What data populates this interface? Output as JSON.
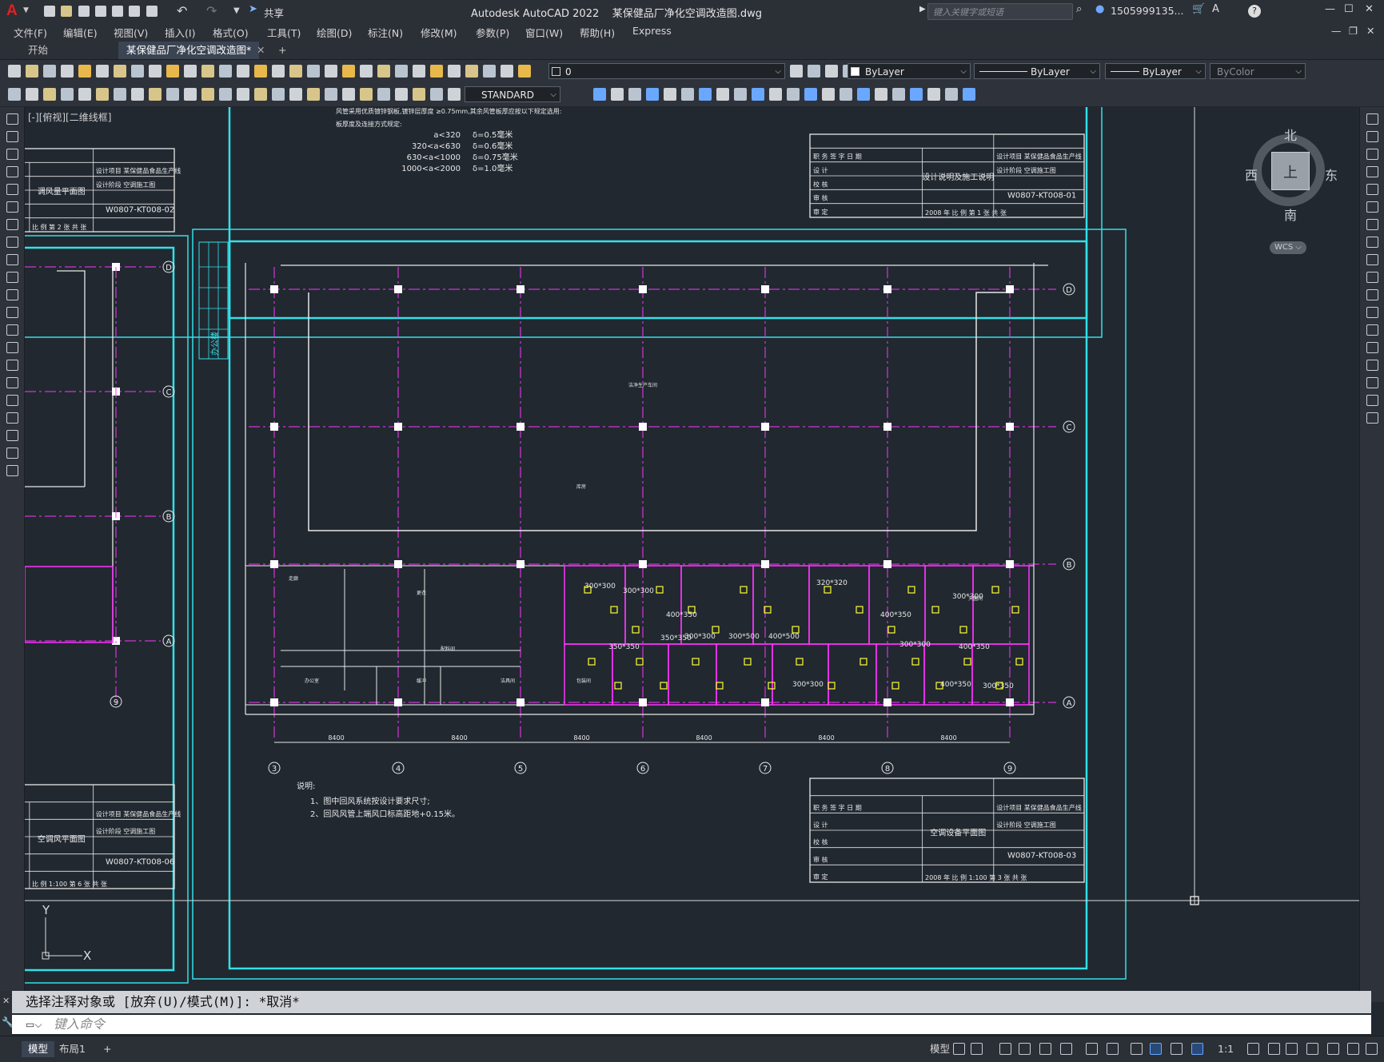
{
  "app": {
    "title": "Autodesk AutoCAD 2022    某保健品厂净化空调改造图.dwg",
    "share_label": "共享",
    "search_placeholder": "键入关键字或短语",
    "user": "1505999135...",
    "help": "?"
  },
  "menu": [
    "文件(F)",
    "编辑(E)",
    "视图(V)",
    "插入(I)",
    "格式(O)",
    "工具(T)",
    "绘图(D)",
    "标注(N)",
    "修改(M)",
    "参数(P)",
    "窗口(W)",
    "帮助(H)",
    "Express"
  ],
  "tabs": [
    {
      "label": "开始"
    },
    {
      "label": "某保健品厂净化空调改造图*"
    }
  ],
  "toolbar": {
    "layer_value": "0",
    "color": "ByLayer",
    "linetype": "ByLayer",
    "lineweight": "ByLayer",
    "plotstyle": "ByColor",
    "textstyle": "STANDARD"
  },
  "viewport_label": "[-][俯视][二维线框]",
  "viewcube": {
    "north": "北",
    "south": "南",
    "east": "东",
    "west": "西",
    "top": "上",
    "wcs": "WCS"
  },
  "drawing": {
    "top_notes": [
      "风管采用优质镀锌钢板,镀锌层厚度 ≥0.75mm,其余风管板厚应按以下规定选用:",
      "板厚度及连接方式规定:"
    ],
    "duct_table": [
      {
        "size": "a<320",
        "thk": "δ=0.5毫米"
      },
      {
        "size": "320<a<630",
        "thk": "δ=0.6毫米"
      },
      {
        "size": "630<a<1000",
        "thk": "δ=0.75毫米"
      },
      {
        "size": "1000<a<2000",
        "thk": "δ=1.0毫米"
      }
    ],
    "title_block_top": {
      "title": "设计说明及施工说明",
      "project": "某保健品食品生产线",
      "stage": "空调施工图",
      "number": "W0807-KT008-01",
      "year": "2008",
      "sheet": "1"
    },
    "title_block_left_top": {
      "title": "调风量平面图",
      "project": "某保健品食品生产线",
      "stage": "空调施工图",
      "number": "W0807-KT008-02",
      "sheet": "2"
    },
    "title_block_left_bottom": {
      "title": "空调风平面图",
      "project": "某保健品食品生产线",
      "stage": "空调施工图",
      "number": "W0807-KT008-06",
      "scale": "1:100",
      "sheet": "6"
    },
    "title_block_main": {
      "title": "空调设备平面图",
      "project": "某保健品食品生产线",
      "stage": "空调施工图",
      "number": "W0807-KT008-03",
      "year": "2008",
      "scale": "1:100",
      "sheet": "3"
    },
    "title_fields": {
      "role1": "职 务",
      "role2": "签 字",
      "role3": "日 期",
      "design": "设 计",
      "check": "校 核",
      "review": "审 核",
      "approve": "审 定",
      "project_lbl": "设计项目",
      "stage_lbl": "设计阶段",
      "year_suffix": "年",
      "scale_lbl": "比 例",
      "sheet_lbl": "第",
      "sheet_of": "张 共",
      "sheet_end": "张"
    },
    "grid_rows": [
      "D",
      "C",
      "B",
      "A"
    ],
    "grid_cols": [
      "3",
      "4",
      "5",
      "6",
      "7",
      "8",
      "9"
    ],
    "span_dims": [
      "8400",
      "8400",
      "8400",
      "8400",
      "8400",
      "8400"
    ],
    "notes_title": "说明:",
    "notes": [
      "1、图中回风系统按设计要求尺寸;",
      "2、回风风管上端风口标高距地+0.15米。"
    ],
    "side_label": "办公楼",
    "duct_labels": [
      "300*300",
      "300*300",
      "400*350",
      "350*350",
      "300*300",
      "300*500",
      "400*500",
      "320*320",
      "400*350",
      "300*300",
      "400*350",
      "300*300",
      "350*350",
      "400*350",
      "300*350",
      "300*300"
    ],
    "room_labels": [
      "洁净生产车间",
      "库房",
      "走廊",
      "更衣",
      "办公室",
      "缓冲",
      "洁具间",
      "包装间",
      "配料间",
      "灭菌间"
    ]
  },
  "ucs": {
    "x": "X",
    "y": "Y"
  },
  "command": {
    "history": "选择注释对象或 [放弃(U)/模式(M)]: *取消*",
    "placeholder": "键入命令"
  },
  "status": {
    "model_tab": "模型",
    "layout_tab": "布局1",
    "add_tab": "+",
    "model_btn": "模型",
    "scale": "1:1"
  }
}
